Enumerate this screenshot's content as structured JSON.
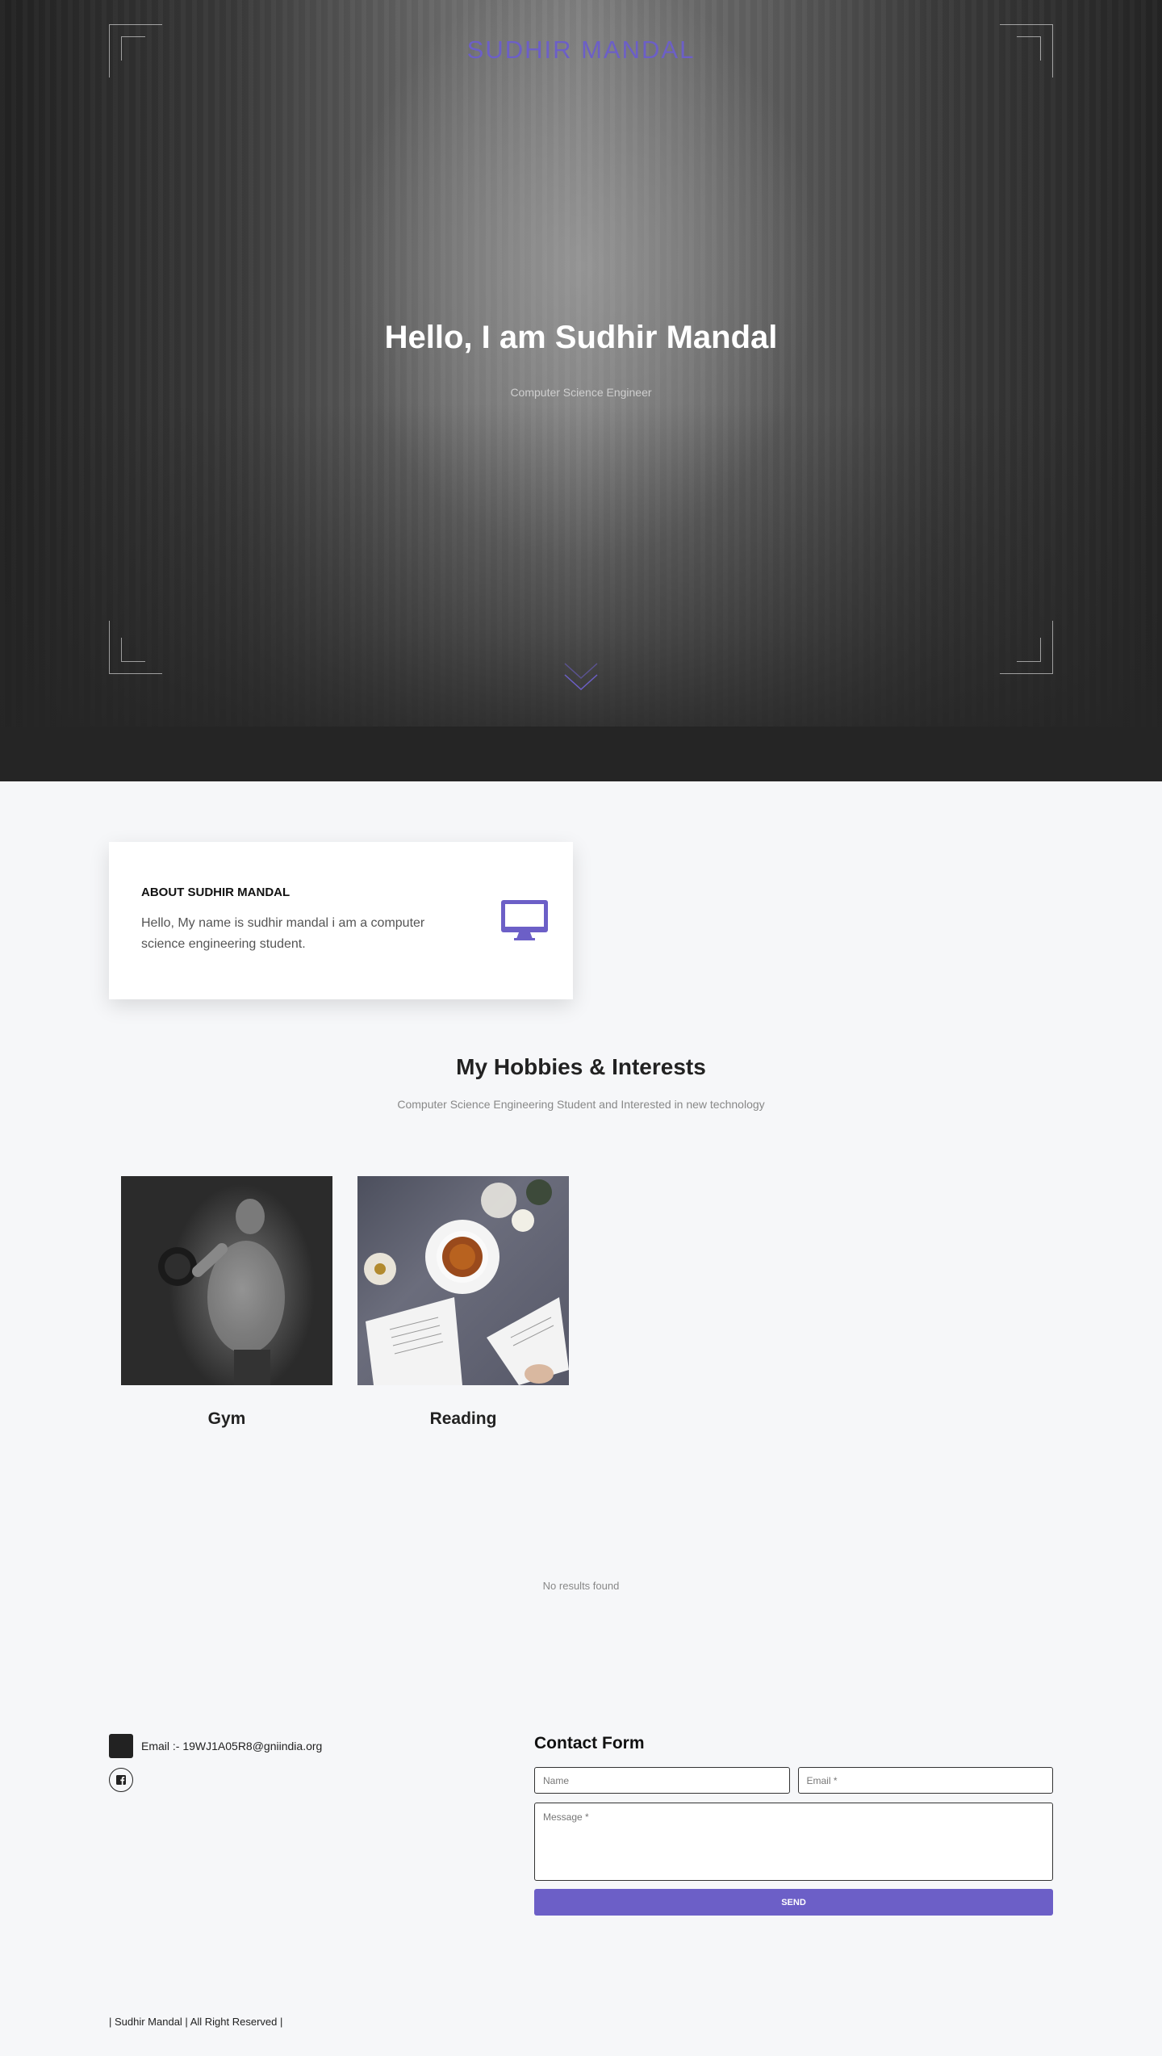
{
  "hero": {
    "brand": "SUDHIR MANDAL",
    "title": "Hello, I am Sudhir Mandal",
    "subtitle": "Computer Science Engineer",
    "scroll_icon": "chevron-double-down-icon"
  },
  "about": {
    "title": "ABOUT SUDHIR MANDAL",
    "text": "Hello, My name is sudhir mandal i am a computer science engineering student.",
    "icon": "desktop-monitor-icon"
  },
  "hobbies": {
    "title": "My Hobbies & Interests",
    "subtitle": "Computer Science Engineering Student and Interested in new technology",
    "items": [
      {
        "label": "Gym"
      },
      {
        "label": "Reading"
      }
    ]
  },
  "empty_state": "No results found",
  "contact": {
    "email_label": "Email :- 19WJ1A05R8@gniindia.org",
    "social_icon": "facebook-icon",
    "form_title": "Contact Form",
    "name_placeholder": "Name",
    "email_placeholder": "Email *",
    "message_placeholder": "Message *",
    "send_label": "SEND"
  },
  "footer": {
    "copyright": "| Sudhir Mandal | All Right Reserved |"
  },
  "colors": {
    "accent": "#6c5fc7",
    "dark": "#252525",
    "page_bg": "#f6f7f9"
  }
}
